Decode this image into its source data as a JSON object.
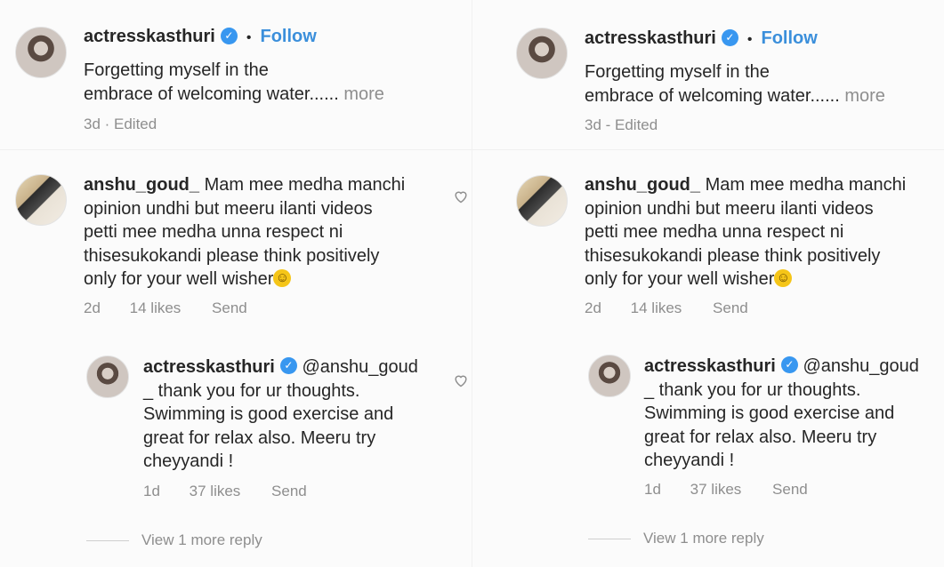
{
  "panels": [
    {
      "post": {
        "username": "actresskasthuri",
        "follow_label": "Follow",
        "caption_line1": "Forgetting myself in the",
        "caption_line2": "embrace of welcoming water......",
        "more_label": "more",
        "meta": "3d · Edited"
      },
      "comment": {
        "username": "anshu_goud_",
        "text_line1": "Mam mee medha manchi",
        "text_line2": "opinion undhi but meeru ilanti videos",
        "text_line3": "petti mee medha unna respect ni",
        "text_line4": "thisesukokandi please think positively",
        "text_line5": "only for your well wisher",
        "emoji": "☺",
        "time": "2d",
        "likes": "14 likes",
        "send": "Send"
      },
      "reply": {
        "username": "actresskasthuri",
        "mention": "@anshu_goud",
        "text_line1": "_ thank you for ur thoughts.",
        "text_line2": "Swimming is good exercise and",
        "text_line3": "great for relax also. Meeru try",
        "text_line4": "cheyyandi !",
        "time": "1d",
        "likes": "37 likes",
        "send": "Send",
        "view_more": "View 1 more reply"
      }
    },
    {
      "post": {
        "username": "actresskasthuri",
        "follow_label": "Follow",
        "caption_line1": "Forgetting myself in the",
        "caption_line2": "embrace of welcoming water......",
        "more_label": "more",
        "meta": "3d - Edited"
      },
      "comment": {
        "username": "anshu_goud_",
        "text_line1": "Mam mee medha manchi",
        "text_line2": "opinion undhi but meeru ilanti videos",
        "text_line3": "petti mee medha unna respect ni",
        "text_line4": "thisesukokandi please think positively",
        "text_line5": "only for your well wisher",
        "emoji": "☺",
        "time": "2d",
        "likes": "14 likes",
        "send": "Send"
      },
      "reply": {
        "username": "actresskasthuri",
        "mention": "@anshu_goud",
        "text_line1": "_ thank you for ur thoughts.",
        "text_line2": "Swimming is good exercise and",
        "text_line3": "great for relax also. Meeru try",
        "text_line4": "cheyyandi !",
        "time": "1d",
        "likes": "37 likes",
        "send": "Send",
        "view_more": "View 1 more reply"
      }
    }
  ],
  "colors": {
    "link": "#3b8fdb",
    "verified": "#3897f0",
    "muted": "#8e8e8e"
  },
  "icons": {
    "verified": "verified-badge-icon",
    "like": "heart-outline-icon"
  }
}
